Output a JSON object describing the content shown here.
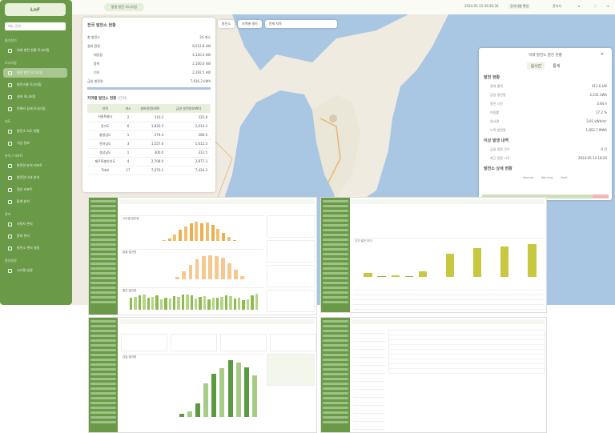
{
  "sidebar": {
    "logo": "LnF",
    "search_placeholder": "메뉴 검색",
    "sections": [
      {
        "title": "즐겨찾기",
        "items": [
          "미래 발전 현황 모니터링"
        ]
      },
      {
        "title": "모니터링",
        "items": [
          "통합 발전 모니터링",
          "발전소별 모니터링",
          "설비 모니터링",
          "인버터 상세 모니터링"
        ]
      },
      {
        "title": "지도",
        "items": [
          "발전소 지도 현황",
          "기상 정보"
        ]
      },
      {
        "title": "분석 / 리포트",
        "items": [
          "발전량 분석 리포트",
          "발전량 비교 분석",
          "정산 리포트",
          "통계 분석"
        ]
      },
      {
        "title": "관리",
        "items": [
          "사용자 관리",
          "장비 관리",
          "발전소 관리 설정"
        ]
      },
      {
        "title": "환경설정",
        "items": [
          "시스템 설정"
        ]
      }
    ]
  },
  "topbar": {
    "breadcrumb": "통합 발전 모니터링",
    "datetime": "2024-05-15 09:20:36",
    "notice": "공지사항 확인",
    "user": "관리자"
  },
  "map_controls": {
    "layer": "발전소",
    "filter": "지역별 필터",
    "select": "전체 지역"
  },
  "left_panel": {
    "title": "전국 발전소 현황",
    "rows": [
      {
        "k": "총 발전소",
        "v": "24 개소"
      },
      {
        "k": "설비 용량",
        "v": "8,512.8 kW"
      },
      {
        "k": "태양광",
        "v": "4,120.3 kW"
      },
      {
        "k": "풍력",
        "v": "2,100.0 kW"
      },
      {
        "k": "기타",
        "v": "2,292.5 kW"
      },
      {
        "k": "금일 발전량",
        "v": "7,916.2 kWh"
      }
    ],
    "table_title": "지역별 발전소 현황",
    "table_unit": "(단위)",
    "headers": [
      "지역",
      "개소",
      "설비용량(kW)",
      "금일 발전량(kWh)"
    ],
    "table": [
      [
        "서울특별시",
        "2",
        "310.2",
        "325.8"
      ],
      [
        "경기도",
        "6",
        "1,920.5",
        "2,010.4"
      ],
      [
        "충청남도",
        "1",
        "274.4",
        "286.0"
      ],
      [
        "전라남도",
        "3",
        "1,557.0",
        "1,612.3"
      ],
      [
        "경상남도",
        "1",
        "300.0",
        "312.5"
      ],
      [
        "제주특별자치도",
        "4",
        "2,708.0",
        "2,877.3"
      ],
      [
        "Total",
        "17",
        "7,070.1",
        "7,424.3"
      ]
    ]
  },
  "right_panel": {
    "title": "미래 발전소 발전 현황",
    "tabs": [
      "실시간",
      "통계"
    ],
    "sec1": "발전 현황",
    "rows1": [
      {
        "k": "현재 출력",
        "v": "412.6 kW"
      },
      {
        "k": "금일 발전량",
        "v": "2,231 kWh"
      },
      {
        "k": "발전 시간",
        "v": "3.84 h"
      },
      {
        "k": "이용률",
        "v": "17.2 %"
      },
      {
        "k": "일사량",
        "v": "3.91 kWh/m²"
      },
      {
        "k": "누적 발전량",
        "v": "1,852.7 MWh"
      }
    ],
    "sec2": "이상 발생 내역",
    "rows2": [
      {
        "k": "금일 알람 건수",
        "v": "0 건"
      },
      {
        "k": "최근 알람 시각",
        "v": "2024-05-14 18:20"
      }
    ],
    "sec3": "발전소 상세 현황",
    "legend": [
      "Normal",
      "Warning",
      "Fault"
    ]
  },
  "chart_data": [
    {
      "type": "bar",
      "title": "시간별 발전량",
      "values": [
        0,
        0,
        0,
        0,
        0,
        0,
        2,
        10,
        30,
        52,
        70,
        84,
        92,
        86,
        90,
        76,
        58,
        38,
        18,
        4,
        0,
        0,
        0,
        0
      ]
    },
    {
      "type": "bar",
      "title": "일별 발전량",
      "values": [
        0,
        0,
        0,
        0,
        0,
        0,
        0,
        8,
        30,
        55,
        75,
        88,
        90,
        88,
        80,
        60,
        36,
        12,
        0,
        0
      ]
    },
    {
      "type": "bar",
      "title": "월간 발전량",
      "values": [
        60,
        62,
        72,
        74,
        58,
        63,
        70,
        50,
        60,
        54,
        66,
        61,
        74,
        73,
        70,
        55,
        64,
        68,
        52,
        60,
        58,
        62,
        70,
        66,
        55,
        59,
        48,
        52,
        70,
        78
      ]
    },
    {
      "type": "bar",
      "title": "주간 발전 추이",
      "values": [
        10,
        3,
        5,
        3,
        15,
        0,
        60,
        0,
        75,
        0,
        78,
        0,
        85
      ]
    },
    {
      "type": "bar",
      "title": "금일 발전량",
      "values": [
        0,
        0,
        0,
        0,
        0,
        0,
        5,
        8,
        20,
        48,
        62,
        70,
        82,
        78,
        72,
        60
      ]
    }
  ]
}
